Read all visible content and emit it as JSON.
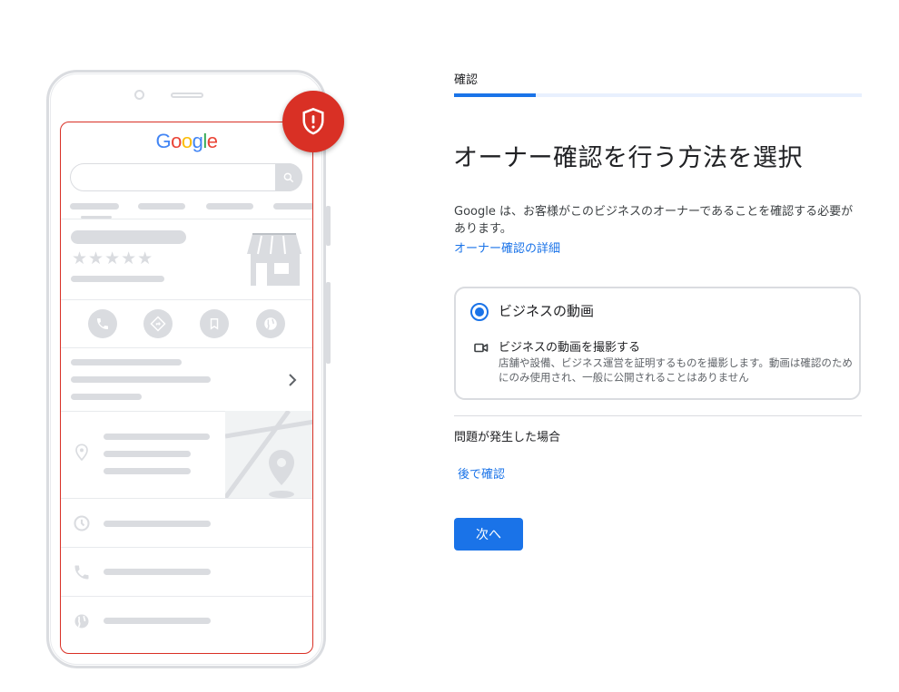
{
  "phone_illustration": {
    "brand_logo": {
      "letters": [
        {
          "char": "G",
          "color": "#4285f4"
        },
        {
          "char": "o",
          "color": "#ea4335"
        },
        {
          "char": "o",
          "color": "#fbbc05"
        },
        {
          "char": "g",
          "color": "#4285f4"
        },
        {
          "char": "l",
          "color": "#34a853"
        },
        {
          "char": "e",
          "color": "#ea4335"
        }
      ]
    },
    "rating_stars": 5,
    "badge_icon": "shield-alert-icon",
    "action_icons": [
      "phone-icon",
      "directions-icon",
      "bookmark-icon",
      "globe-icon"
    ],
    "info_icons": [
      "location-pin-icon",
      "clock-icon",
      "phone-icon",
      "globe-icon"
    ]
  },
  "step": {
    "label": "確認",
    "progress": 0.2
  },
  "title": "オーナー確認を行う方法を選択",
  "description": "Google は、お客様がこのビジネスのオーナーであることを確認する必要があります。",
  "learn_more_link": "オーナー確認の詳細",
  "option": {
    "title": "ビジネスの動画",
    "selected": true,
    "icon": "videocam-icon",
    "subtitle": "ビジネスの動画を撮影する",
    "detail": "店舗や設備、ビジネス運営を証明するものを撮影します。動画は確認のためにのみ使用され、一般に公開されることはありません"
  },
  "problem_heading": "問題が発生した場合",
  "later_link": "後で確認",
  "next_button": "次へ",
  "colors": {
    "accent": "#1a73e8",
    "alert": "#d93025",
    "placeholder": "#dadce0"
  }
}
